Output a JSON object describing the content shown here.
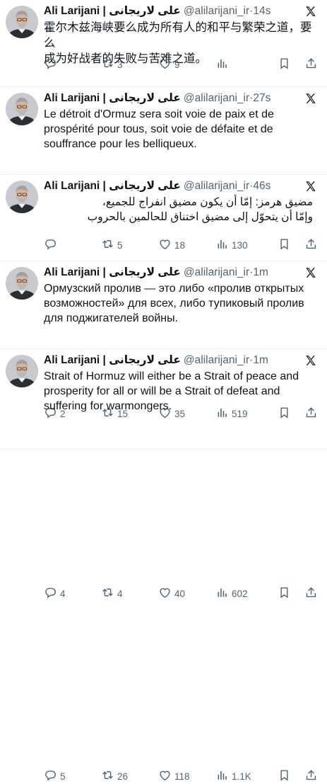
{
  "author": {
    "name": "Ali Larijani | علی لاریجانی",
    "handle": "@alilarijani_ir"
  },
  "tweets": [
    {
      "time": "14s",
      "lang": "zh",
      "text": "霍尔木兹海峡要么成为所有人的和平与繁荣之道，要么\n成为好战者的失败与苦难之道。",
      "replies": "",
      "retweets": "3",
      "likes": "9",
      "views": ""
    },
    {
      "time": "27s",
      "lang": "fr",
      "text": "Le détroit d'Ormuz sera soit voie de paix et de\nprospérité pour tous, soit voie de défaite et de\nsouffrance pour les belliqueux.",
      "replies": "",
      "retweets": "5",
      "likes": "18",
      "views": "130"
    },
    {
      "time": "46s",
      "lang": "ar",
      "text": "مضيق هرمز: إمّا أن يكون مضيق انفراج للجميع،\nوإمّا أن يتحوّل إلى مضيق اختناق للحالمين بالحروب",
      "replies": "2",
      "retweets": "15",
      "likes": "35",
      "views": "519"
    },
    {
      "time": "1m",
      "lang": "ru",
      "text": "Ормузский пролив — это либо «пролив открытых\nвозможностей» для всех, либо тупиковый пролив\nдля поджигателей войны.",
      "replies": "4",
      "retweets": "4",
      "likes": "40",
      "views": "602"
    },
    {
      "time": "1m",
      "lang": "en",
      "text": "Strait of Hormuz will either be a Strait of peace and\nprosperity for all or will be a Strait of defeat and\nsuffering for warmongers.",
      "replies": "5",
      "retweets": "26",
      "likes": "118",
      "views": "1.1K"
    }
  ],
  "separator": " · ",
  "icons": {
    "reply": "reply-icon",
    "retweet": "retweet-icon",
    "like": "heart-icon",
    "views": "views-icon",
    "bookmark": "bookmark-icon",
    "share": "share-icon",
    "platform": "x-logo-icon"
  },
  "colors": {
    "text": "#0f1419",
    "muted": "#536471",
    "divider": "#eff3f4"
  }
}
